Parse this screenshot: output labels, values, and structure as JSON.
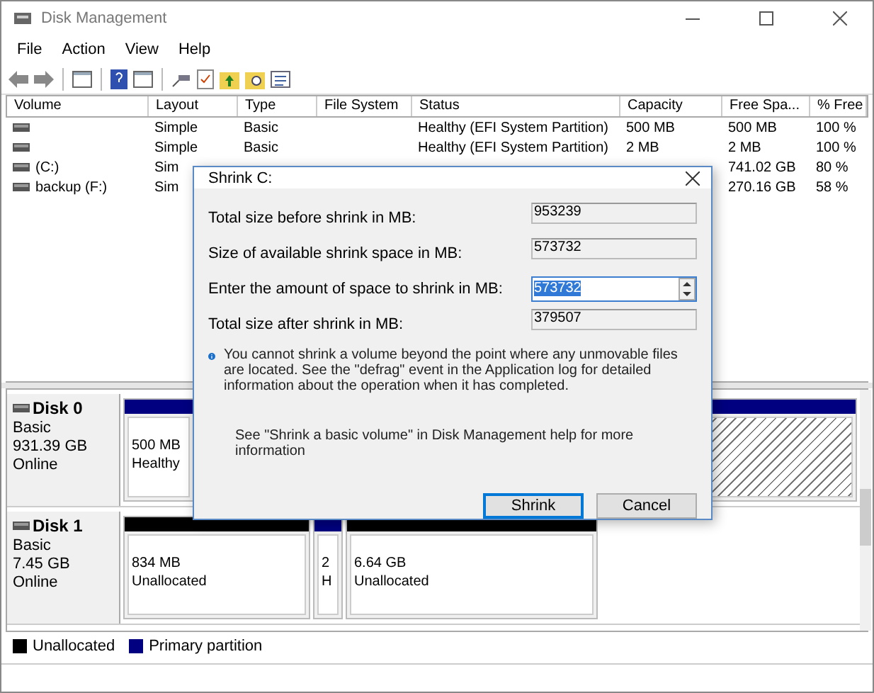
{
  "window": {
    "title": "Disk Management"
  },
  "menu": [
    "File",
    "Action",
    "View",
    "Help"
  ],
  "table": {
    "columns": [
      "Volume",
      "Layout",
      "Type",
      "File System",
      "Status",
      "Capacity",
      "Free Spa...",
      "% Free"
    ],
    "rows": [
      {
        "volume": "",
        "layout": "Simple",
        "type": "Basic",
        "status": "Healthy (EFI System Partition)",
        "capacity": "500 MB",
        "free_space": "500 MB",
        "percent_free": "100 %"
      },
      {
        "layout": "Simple",
        "type": "Basic",
        "status": "Healthy (EFI System Partition)",
        "capacity": "2 MB",
        "free_space": "2 MB",
        "percent_free": "100 %"
      },
      {
        "volume": "(C:)",
        "layout": "Sim",
        "free_space": "741.02 GB",
        "percent_free": "80 %"
      },
      {
        "volume": "backup (F:)",
        "layout": "Sim",
        "free_space": "270.16 GB",
        "percent_free": "58 %"
      }
    ]
  },
  "disks": [
    {
      "name": "Disk 0",
      "type": "Basic",
      "size": "931.39 GB",
      "status": "Online",
      "partitions": [
        {
          "kind": "primary",
          "selected": false,
          "lines": [
            "500 MB",
            "Healthy"
          ]
        },
        {
          "kind": "primary",
          "selected": true
        }
      ]
    },
    {
      "name": "Disk 1",
      "type": "Basic",
      "size": "7.45 GB",
      "status": "Online",
      "partitions": [
        {
          "kind": "unallocated",
          "selected": false,
          "lines": [
            "834 MB",
            "Unallocated"
          ]
        },
        {
          "kind": "primary",
          "selected": false,
          "lines": [
            "2",
            "H"
          ]
        },
        {
          "kind": "unallocated",
          "selected": false,
          "lines": [
            "6.64 GB",
            "Unallocated"
          ]
        }
      ]
    }
  ],
  "legend": [
    {
      "label": "Unallocated",
      "color": "#000000"
    },
    {
      "label": "Primary partition",
      "color": "#000080"
    }
  ],
  "dialog": {
    "title": "Shrink C:",
    "fields": [
      {
        "label": "Total size before shrink in MB:",
        "value": "953239",
        "kind": "readonly"
      },
      {
        "label": "Size of available shrink space in MB:",
        "value": "573732",
        "kind": "readonly"
      },
      {
        "label": "Enter the amount of space to shrink in MB:",
        "value": "573732",
        "kind": "spin"
      },
      {
        "label": "Total size after shrink in MB:",
        "value": "379507",
        "kind": "readonly"
      }
    ],
    "info": "You cannot shrink a volume beyond the point where any unmovable files are located. See the \"defrag\" event in the Application log for detailed information about the operation when it has completed.",
    "help_note": "See \"Shrink a basic volume\" in Disk Management help for more information",
    "buttons": [
      {
        "label": "Shrink",
        "default": true
      },
      {
        "label": "Cancel",
        "default": false
      }
    ]
  }
}
